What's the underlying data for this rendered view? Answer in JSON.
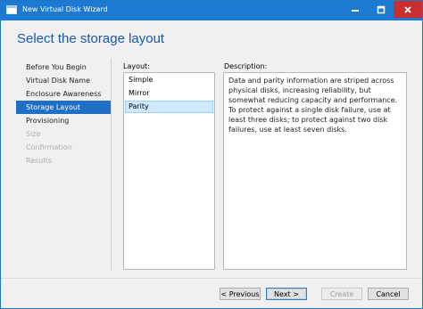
{
  "window": {
    "title": "New Virtual Disk Wizard",
    "controls": {
      "minimize": "—",
      "maximize": "□",
      "close": "✕"
    }
  },
  "page": {
    "heading": "Select the storage layout"
  },
  "nav": {
    "items": [
      {
        "label": "Before You Begin",
        "state": "normal"
      },
      {
        "label": "Virtual Disk Name",
        "state": "normal"
      },
      {
        "label": "Enclosure Awareness",
        "state": "normal"
      },
      {
        "label": "Storage Layout",
        "state": "active"
      },
      {
        "label": "Provisioning",
        "state": "normal"
      },
      {
        "label": "Size",
        "state": "disabled"
      },
      {
        "label": "Confirmation",
        "state": "disabled"
      },
      {
        "label": "Results",
        "state": "disabled"
      }
    ]
  },
  "layout": {
    "label": "Layout:",
    "options": [
      "Simple",
      "Mirror",
      "Parity"
    ],
    "selected": "Parity"
  },
  "description": {
    "label": "Description:",
    "text": "Data and parity information are striped across physical disks, increasing reliability, but somewhat reducing capacity and performance. To protect against a single disk failure, use at least three disks; to protect against two disk failures, use at least seven disks."
  },
  "buttons": {
    "previous": "< Previous",
    "next": "Next >",
    "create": "Create",
    "cancel": "Cancel"
  },
  "colors": {
    "titlebar": "#1c7ad2",
    "heading": "#1a5aa8",
    "nav_active": "#1f6fc5",
    "close_button": "#c7302f",
    "selection": "#cde8ff"
  }
}
